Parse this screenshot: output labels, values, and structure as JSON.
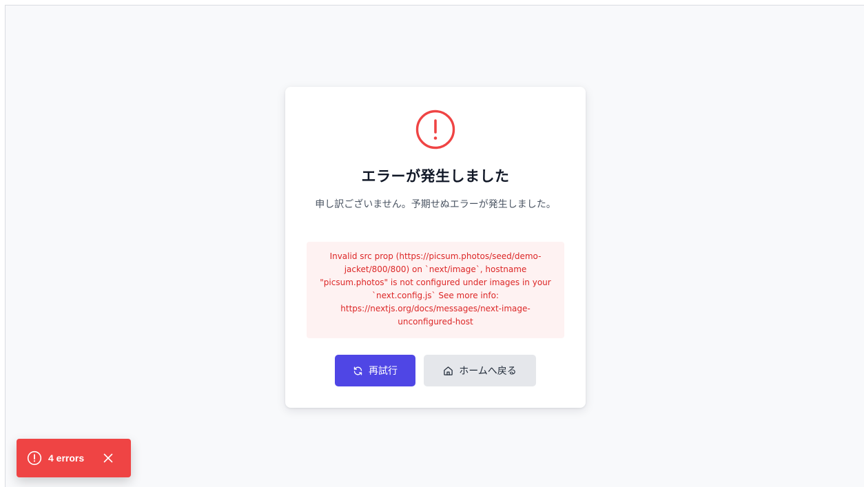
{
  "error_card": {
    "title": "エラーが発生しました",
    "message": "申し訳ございません。予期せぬエラーが発生しました。",
    "error_detail": "Invalid src prop (https://picsum.photos/seed/demo-jacket/800/800) on `next/image`, hostname \"picsum.photos\" is not configured under images in your `next.config.js` See more info: https://nextjs.org/docs/messages/next-image-unconfigured-host",
    "alert_icon": "exclamation-circle-icon",
    "retry_button": {
      "label": "再試行",
      "icon": "refresh-icon"
    },
    "home_button": {
      "label": "ホームへ戻る",
      "icon": "home-icon"
    }
  },
  "error_toast": {
    "label": "4 errors",
    "icon": "exclamation-circle-icon",
    "close_icon": "close-icon"
  },
  "colors": {
    "danger": "#ef4444",
    "danger_text": "#dc2626",
    "error_bg": "#fef2f2",
    "primary": "#4f46e5",
    "secondary_bg": "#e5e7eb",
    "page_bg": "#f8f9fb"
  }
}
